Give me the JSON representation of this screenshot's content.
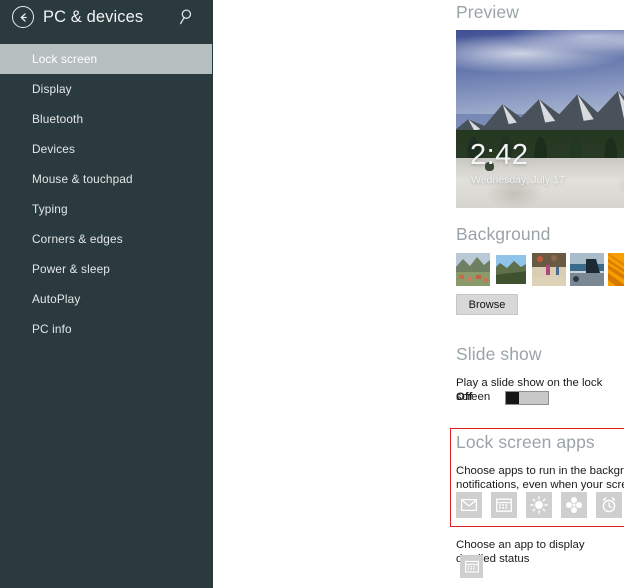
{
  "sidebar": {
    "title": "PC & devices",
    "back_icon": "back-arrow-icon",
    "search_icon": "search-icon",
    "items": [
      {
        "label": "Lock screen",
        "selected": true
      },
      {
        "label": "Display",
        "selected": false
      },
      {
        "label": "Bluetooth",
        "selected": false
      },
      {
        "label": "Devices",
        "selected": false
      },
      {
        "label": "Mouse & touchpad",
        "selected": false
      },
      {
        "label": "Typing",
        "selected": false
      },
      {
        "label": "Corners & edges",
        "selected": false
      },
      {
        "label": "Power & sleep",
        "selected": false
      },
      {
        "label": "AutoPlay",
        "selected": false
      },
      {
        "label": "PC info",
        "selected": false
      }
    ]
  },
  "preview": {
    "heading": "Preview",
    "clock_time": "2:42",
    "clock_date": "Wednesday, July 17",
    "image_description": "Flatirons mountains with snow-covered field"
  },
  "background": {
    "heading": "Background",
    "browse_label": "Browse",
    "thumbnails": [
      {
        "name": "village-mountains",
        "selected": false
      },
      {
        "name": "blue-sky-mountains",
        "selected": true
      },
      {
        "name": "market-beach",
        "selected": false
      },
      {
        "name": "coastal-shore",
        "selected": false
      },
      {
        "name": "orange-abstract",
        "selected": false
      }
    ]
  },
  "slideshow": {
    "heading": "Slide show",
    "description": "Play a slide show on the lock screen",
    "toggle_state": "Off"
  },
  "lock_screen_apps": {
    "heading": "Lock screen apps",
    "description": "Choose apps to run in the background and show quick status and notifications, even when your screen is locked",
    "highlight_color": "#e02020",
    "apps": [
      {
        "icon": "mail-icon"
      },
      {
        "icon": "calendar-icon"
      },
      {
        "icon": "weather-sun-icon"
      },
      {
        "icon": "messaging-icon"
      },
      {
        "icon": "alarm-clock-icon"
      },
      {
        "icon": "plus-icon",
        "label": "+"
      },
      {
        "icon": "plus-icon",
        "label": "+"
      }
    ]
  },
  "detailed_status": {
    "description": "Choose an app to display detailed status",
    "app_icon": "calendar-icon"
  },
  "colors": {
    "sidebar_bg": "#2b3a3f",
    "sidebar_selected": "#b6bfbf",
    "heading": "#9aa4a8",
    "highlight": "#e02020"
  }
}
